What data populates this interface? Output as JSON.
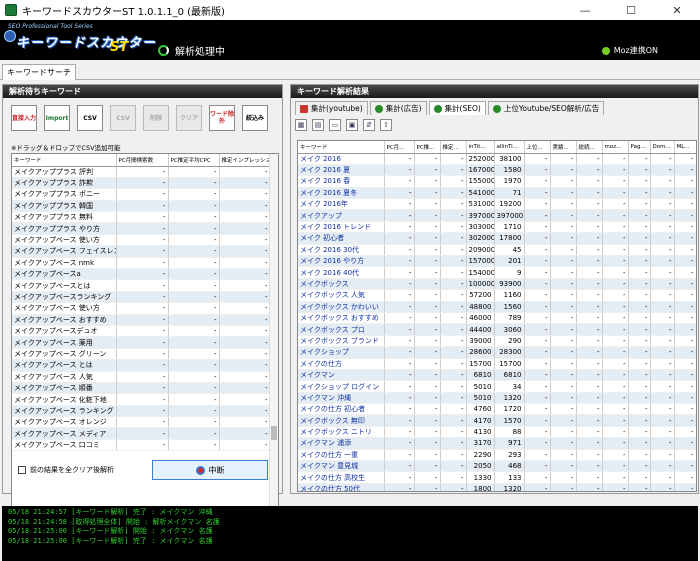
{
  "window": {
    "title": "キーワードスカウターST 1.0.1.1_0 (最新版)",
    "minimize": "—",
    "maximize": "☐",
    "close": "✕"
  },
  "header": {
    "logo_tag": "SEO Professional Tool Series",
    "logo_name": "キーワードスカウター",
    "logo_st": "ST",
    "status": "解析処理中",
    "moz_status": "Moz連携ON"
  },
  "main_tab": "キーワードサーチ",
  "left": {
    "title": "解析待ちキーワード",
    "tools": [
      "直接入力",
      "Import",
      "CSV",
      "CSV",
      "削除",
      "クリア",
      "ワード除外",
      "絞込み"
    ],
    "drop_note": "※ドラッグ＆ドロップでCSV追加可能",
    "columns": [
      "キーワード",
      "PC月間検索数",
      "PC推定平均CPC",
      "推定インプレッション..."
    ],
    "rows": [
      [
        "メイクアッププラス 評判",
        "-",
        "-",
        "-"
      ],
      [
        "メイクアッププラス 詐欺",
        "-",
        "-",
        "-"
      ],
      [
        "メイクアッププラス ポニー",
        "-",
        "-",
        "-"
      ],
      [
        "メイクアッププラス 韓国",
        "-",
        "-",
        "-"
      ],
      [
        "メイクアッププラス 無料",
        "-",
        "-",
        "-"
      ],
      [
        "メイクアッププラス やり方",
        "-",
        "-",
        "-"
      ],
      [
        "メイクアップベース 使い方",
        "-",
        "-",
        "-"
      ],
      [
        "メイクアップベース フェイスレス...",
        "-",
        "-",
        "-"
      ],
      [
        "メイクアップベース nmk",
        "-",
        "-",
        "-"
      ],
      [
        "メイクアップベースa",
        "-",
        "-",
        "-"
      ],
      [
        "メイクアップベースとは",
        "-",
        "-",
        "-"
      ],
      [
        "メイクアップベースランキング",
        "-",
        "-",
        "-"
      ],
      [
        "メイクアップベース 使い方",
        "-",
        "-",
        "-"
      ],
      [
        "メイクアップベース おすすめ",
        "-",
        "-",
        "-"
      ],
      [
        "メイクアップベースデュオ",
        "-",
        "-",
        "-"
      ],
      [
        "メイクアップベース 薬用",
        "-",
        "-",
        "-"
      ],
      [
        "メイクアップベース グリーン",
        "-",
        "-",
        "-"
      ],
      [
        "メイクアップベース とは",
        "-",
        "-",
        "-"
      ],
      [
        "メイクアップベース 人気",
        "-",
        "-",
        "-"
      ],
      [
        "メイクアップベース 順番",
        "-",
        "-",
        "-"
      ],
      [
        "メイクアップベース 化粧下地",
        "-",
        "-",
        "-"
      ],
      [
        "メイクアップベース ランキング",
        "-",
        "-",
        "-"
      ],
      [
        "メイクアップベース オレンジ",
        "-",
        "-",
        "-"
      ],
      [
        "メイクアップベース メディア",
        "-",
        "-",
        "-"
      ],
      [
        "メイクアップベース 口コミ",
        "-",
        "-",
        "-"
      ]
    ],
    "clear_option": "前の結果を全クリア後解析",
    "stop_label": "中断"
  },
  "right": {
    "title": "キーワード解析結果",
    "tabs": [
      "集計(youtube)",
      "集計(広告)",
      "集計(SEO)",
      "上位Youtube/SEO解析/広告"
    ],
    "subtools": [
      "▦",
      "▤",
      "▭",
      "▣",
      "⇵",
      "⇧"
    ],
    "columns": [
      "キーワード",
      "PC月...",
      "PC推...",
      "推定...",
      "inTit...",
      "allinTi...",
      "上位...",
      "実績...",
      "総続...",
      "moz...",
      "Pag...",
      "Dom...",
      "ML..."
    ],
    "rows": [
      [
        "メイク 2016",
        "-",
        "-",
        "-",
        "2520000",
        "38100",
        "-",
        "-",
        "-",
        "-",
        "-",
        "-",
        "-"
      ],
      [
        "メイク 2016 夏",
        "-",
        "-",
        "-",
        "1670000",
        "1580",
        "-",
        "-",
        "-",
        "-",
        "-",
        "-",
        "-"
      ],
      [
        "メイク 2016 春",
        "-",
        "-",
        "-",
        "1550000",
        "1970",
        "-",
        "-",
        "-",
        "-",
        "-",
        "-",
        "-"
      ],
      [
        "メイク 2016 夏冬",
        "-",
        "-",
        "-",
        "541000",
        "71",
        "-",
        "-",
        "-",
        "-",
        "-",
        "-",
        "-"
      ],
      [
        "メイク 2016年",
        "-",
        "-",
        "-",
        "531000",
        "19200",
        "-",
        "-",
        "-",
        "-",
        "-",
        "-",
        "-"
      ],
      [
        "メイクアップ",
        "-",
        "-",
        "-",
        "397000",
        "397000",
        "-",
        "-",
        "-",
        "-",
        "-",
        "-",
        "-"
      ],
      [
        "メイク 2016 トレンド",
        "-",
        "-",
        "-",
        "303000",
        "1710",
        "-",
        "-",
        "-",
        "-",
        "-",
        "-",
        "-"
      ],
      [
        "メイク 初心者",
        "-",
        "-",
        "-",
        "302000",
        "17800",
        "-",
        "-",
        "-",
        "-",
        "-",
        "-",
        "-"
      ],
      [
        "メイク 2016 30代",
        "-",
        "-",
        "-",
        "209000",
        "45",
        "-",
        "-",
        "-",
        "-",
        "-",
        "-",
        "-"
      ],
      [
        "メイク 2016 やり方",
        "-",
        "-",
        "-",
        "157000",
        "201",
        "-",
        "-",
        "-",
        "-",
        "-",
        "-",
        "-"
      ],
      [
        "メイク 2016 40代",
        "-",
        "-",
        "-",
        "154000",
        "9",
        "-",
        "-",
        "-",
        "-",
        "-",
        "-",
        "-"
      ],
      [
        "メイクボックス",
        "-",
        "-",
        "-",
        "100000",
        "93900",
        "-",
        "-",
        "-",
        "-",
        "-",
        "-",
        "-"
      ],
      [
        "メイクボックス 人気",
        "-",
        "-",
        "-",
        "57200",
        "1160",
        "-",
        "-",
        "-",
        "-",
        "-",
        "-",
        "-"
      ],
      [
        "メイクボックス かわいい",
        "-",
        "-",
        "-",
        "48800",
        "1560",
        "-",
        "-",
        "-",
        "-",
        "-",
        "-",
        "-"
      ],
      [
        "メイクボックス おすすめ",
        "-",
        "-",
        "-",
        "46000",
        "789",
        "-",
        "-",
        "-",
        "-",
        "-",
        "-",
        "-"
      ],
      [
        "メイクボックス プロ",
        "-",
        "-",
        "-",
        "44400",
        "3060",
        "-",
        "-",
        "-",
        "-",
        "-",
        "-",
        "-"
      ],
      [
        "メイクボックス ブランド",
        "-",
        "-",
        "-",
        "39000",
        "290",
        "-",
        "-",
        "-",
        "-",
        "-",
        "-",
        "-"
      ],
      [
        "メイクショップ",
        "-",
        "-",
        "-",
        "28600",
        "28300",
        "-",
        "-",
        "-",
        "-",
        "-",
        "-",
        "-"
      ],
      [
        "メイクの仕方",
        "-",
        "-",
        "-",
        "15700",
        "15700",
        "-",
        "-",
        "-",
        "-",
        "-",
        "-",
        "-"
      ],
      [
        "メイクマン",
        "-",
        "-",
        "-",
        "6810",
        "6810",
        "-",
        "-",
        "-",
        "-",
        "-",
        "-",
        "-"
      ],
      [
        "メイクショップ ログイン",
        "-",
        "-",
        "-",
        "5010",
        "34",
        "-",
        "-",
        "-",
        "-",
        "-",
        "-",
        "-"
      ],
      [
        "メイクマン 沖縄",
        "-",
        "-",
        "-",
        "5010",
        "1320",
        "-",
        "-",
        "-",
        "-",
        "-",
        "-",
        "-"
      ],
      [
        "メイクの仕方 初心者",
        "-",
        "-",
        "-",
        "4760",
        "1720",
        "-",
        "-",
        "-",
        "-",
        "-",
        "-",
        "-"
      ],
      [
        "メイクボックス 無印",
        "-",
        "-",
        "-",
        "4170",
        "1570",
        "-",
        "-",
        "-",
        "-",
        "-",
        "-",
        "-"
      ],
      [
        "メイクボックス ニトリ",
        "-",
        "-",
        "-",
        "4130",
        "88",
        "-",
        "-",
        "-",
        "-",
        "-",
        "-",
        "-"
      ],
      [
        "メイクマン 浦添",
        "-",
        "-",
        "-",
        "3170",
        "971",
        "-",
        "-",
        "-",
        "-",
        "-",
        "-",
        "-"
      ],
      [
        "メイクの仕方 一重",
        "-",
        "-",
        "-",
        "2290",
        "293",
        "-",
        "-",
        "-",
        "-",
        "-",
        "-",
        "-"
      ],
      [
        "メイクマン 豊見城",
        "-",
        "-",
        "-",
        "2050",
        "468",
        "-",
        "-",
        "-",
        "-",
        "-",
        "-",
        "-"
      ],
      [
        "メイクの仕方 高校生",
        "-",
        "-",
        "-",
        "1330",
        "133",
        "-",
        "-",
        "-",
        "-",
        "-",
        "-",
        "-"
      ],
      [
        "メイクの仕方 50代",
        "-",
        "-",
        "-",
        "1800",
        "1320",
        "-",
        "-",
        "-",
        "-",
        "-",
        "-",
        "-"
      ]
    ]
  },
  "log": [
    "05/18 21:24:57 [キーワード解析] 完了 : メイクマン 沖縄",
    "05/18 21:24:58 [取得処理全体] 開始 : 解析メイクマン 名護",
    "05/18 21:25:00 [キーワード解析] 開始 : メイクマン 名護",
    "05/18 21:25:00 [キーワード解析] 完了 : メイクマン 名護"
  ],
  "colors": {
    "log_text": "#33cc33",
    "header_bg": "#000000",
    "alt_row": "#e4ecf4",
    "keyword_link": "#1030a0"
  }
}
